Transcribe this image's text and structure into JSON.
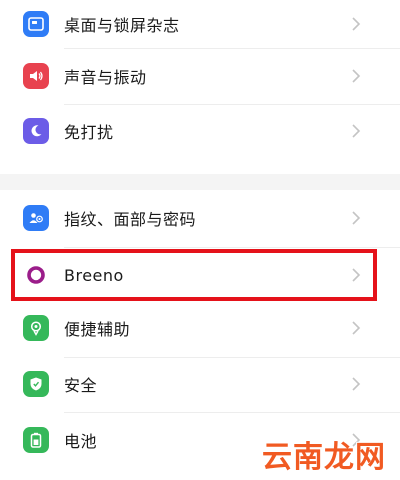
{
  "settings": {
    "group1": [
      {
        "label": "桌面与锁屏杂志",
        "icon": "wallpaper-icon",
        "color": "#2f7cf6"
      },
      {
        "label": "声音与振动",
        "icon": "speaker-icon",
        "color": "#e8424f"
      },
      {
        "label": "免打扰",
        "icon": "moon-icon",
        "color": "#6c5ce7"
      }
    ],
    "group2": [
      {
        "label": "指纹、面部与密码",
        "icon": "fingerprint-user-icon",
        "color": "#2f7cf6"
      },
      {
        "label": "Breeno",
        "icon": "breeno-icon",
        "color": "#9b1d8a"
      },
      {
        "label": "便捷辅助",
        "icon": "hand-assist-icon",
        "color": "#35b85a"
      },
      {
        "label": "安全",
        "icon": "shield-icon",
        "color": "#35b85a"
      },
      {
        "label": "电池",
        "icon": "battery-icon",
        "color": "#35b85a"
      }
    ]
  },
  "watermark": {
    "text": "云南龙网"
  },
  "colors": {
    "highlight": "#e5121a",
    "watermark": "#f15a22"
  }
}
